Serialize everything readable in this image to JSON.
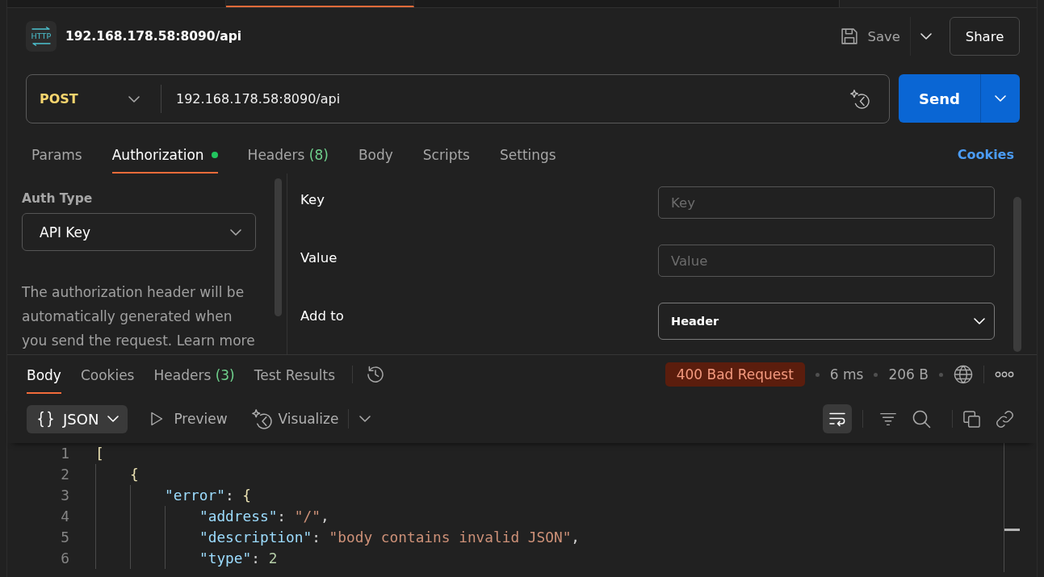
{
  "tab_strip": {
    "tabs": [
      {
        "selected": false
      },
      {
        "selected": true
      },
      {
        "selected": false
      }
    ]
  },
  "request": {
    "icon_label": "HTTP",
    "title": "192.168.178.58:8090/api",
    "save_label": "Save",
    "share_label": "Share"
  },
  "url_bar": {
    "method": "POST",
    "url": "192.168.178.58:8090/api",
    "send_label": "Send"
  },
  "request_tabs": [
    {
      "label": "Params",
      "selected": false,
      "configured": false
    },
    {
      "label": "Authorization",
      "selected": true,
      "configured": true
    },
    {
      "label": "Headers",
      "count": "(8)",
      "selected": false,
      "configured": false
    },
    {
      "label": "Body",
      "selected": false,
      "configured": false
    },
    {
      "label": "Scripts",
      "selected": false,
      "configured": false
    },
    {
      "label": "Settings",
      "selected": false,
      "configured": false
    }
  ],
  "cookies_link": "Cookies",
  "auth": {
    "type_label": "Auth Type",
    "type_value": "API Key",
    "description": "The authorization header will be automatically generated when you send the request. Learn more",
    "fields": [
      {
        "kind": "input",
        "label": "Key",
        "placeholder": "Key"
      },
      {
        "kind": "input",
        "label": "Value",
        "placeholder": "Value"
      },
      {
        "kind": "select",
        "label": "Add to",
        "value": "Header"
      }
    ]
  },
  "response": {
    "tabs": [
      {
        "label": "Body",
        "selected": true
      },
      {
        "label": "Cookies",
        "selected": false
      },
      {
        "label": "Headers",
        "count": "(3)",
        "selected": false
      },
      {
        "label": "Test Results",
        "selected": false
      }
    ],
    "status": "400 Bad Request",
    "time": "6 ms",
    "size": "206 B",
    "format": "JSON",
    "preview_label": "Preview",
    "visualize_label": "Visualize",
    "wrap_lines": true,
    "code": [
      {
        "number": "1",
        "tokens": [
          {
            "kind": "bracket",
            "text": "["
          }
        ],
        "children": [
          {
            "number": "2",
            "tokens": [
              {
                "kind": "bracket",
                "text": "{"
              }
            ],
            "children": [
              {
                "number": "3",
                "tokens": [
                  {
                    "kind": "key",
                    "text": "\"error\""
                  },
                  {
                    "kind": "punct",
                    "text": ": "
                  },
                  {
                    "kind": "bracket",
                    "text": "{"
                  }
                ],
                "children": [
                  {
                    "number": "4",
                    "tokens": [
                      {
                        "kind": "key",
                        "text": "\"address\""
                      },
                      {
                        "kind": "punct",
                        "text": ": "
                      },
                      {
                        "kind": "string",
                        "text": "\"/\""
                      },
                      {
                        "kind": "punct",
                        "text": ","
                      }
                    ]
                  },
                  {
                    "number": "5",
                    "tokens": [
                      {
                        "kind": "key",
                        "text": "\"description\""
                      },
                      {
                        "kind": "punct",
                        "text": ": "
                      },
                      {
                        "kind": "string",
                        "text": "\"body contains invalid JSON\""
                      },
                      {
                        "kind": "punct",
                        "text": ","
                      }
                    ]
                  },
                  {
                    "number": "6",
                    "tokens": [
                      {
                        "kind": "key",
                        "text": "\"type\""
                      },
                      {
                        "kind": "punct",
                        "text": ": "
                      },
                      {
                        "kind": "number",
                        "text": "2"
                      }
                    ]
                  }
                ]
              }
            ]
          }
        ]
      }
    ]
  }
}
